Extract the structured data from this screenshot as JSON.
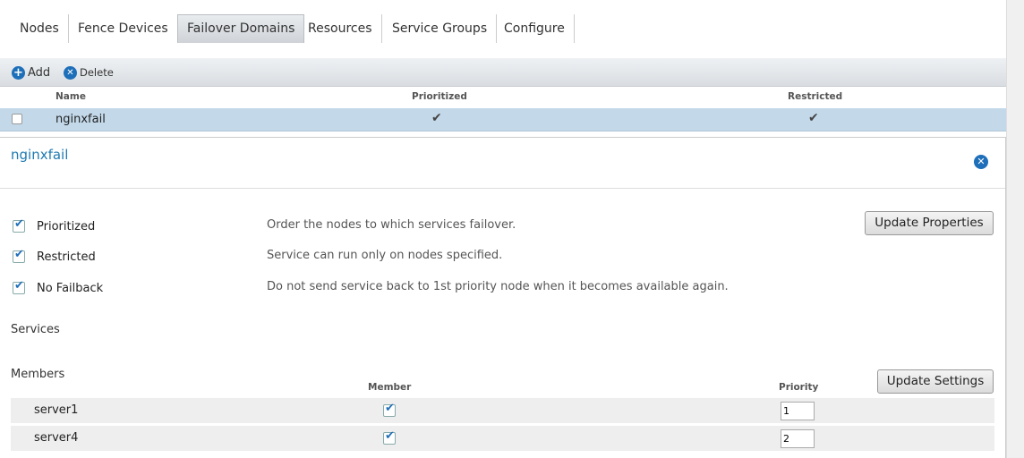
{
  "tabs": [
    {
      "label": "Nodes"
    },
    {
      "label": "Fence Devices"
    },
    {
      "label": "Failover Domains",
      "active": true
    },
    {
      "label": "Resources"
    },
    {
      "label": "Service Groups"
    },
    {
      "label": "Configure"
    }
  ],
  "toolbar": {
    "add_label": "Add",
    "delete_label": "Delete"
  },
  "list": {
    "headers": {
      "name": "Name",
      "prioritized": "Prioritized",
      "restricted": "Restricted"
    },
    "rows": [
      {
        "name": "nginxfail",
        "prioritized": "✔",
        "restricted": "✔"
      }
    ]
  },
  "detail": {
    "title": "nginxfail",
    "properties": [
      {
        "label": "Prioritized",
        "desc": "Order the nodes to which services failover.",
        "checked": true
      },
      {
        "label": "Restricted",
        "desc": "Service can run only on nodes specified.",
        "checked": true
      },
      {
        "label": "No Failback",
        "desc": "Do not send service back to 1st priority node when it becomes available again.",
        "checked": true
      }
    ],
    "update_properties_label": "Update Properties",
    "services_label": "Services",
    "members_label": "Members",
    "member_header": "Member",
    "priority_header": "Priority",
    "update_settings_label": "Update Settings",
    "members": [
      {
        "name": "server1",
        "member": true,
        "priority": "1"
      },
      {
        "name": "server4",
        "member": true,
        "priority": "2"
      }
    ]
  },
  "colors": {
    "accent": "#1e6fb9",
    "selected_row": "#c3d9ea"
  }
}
